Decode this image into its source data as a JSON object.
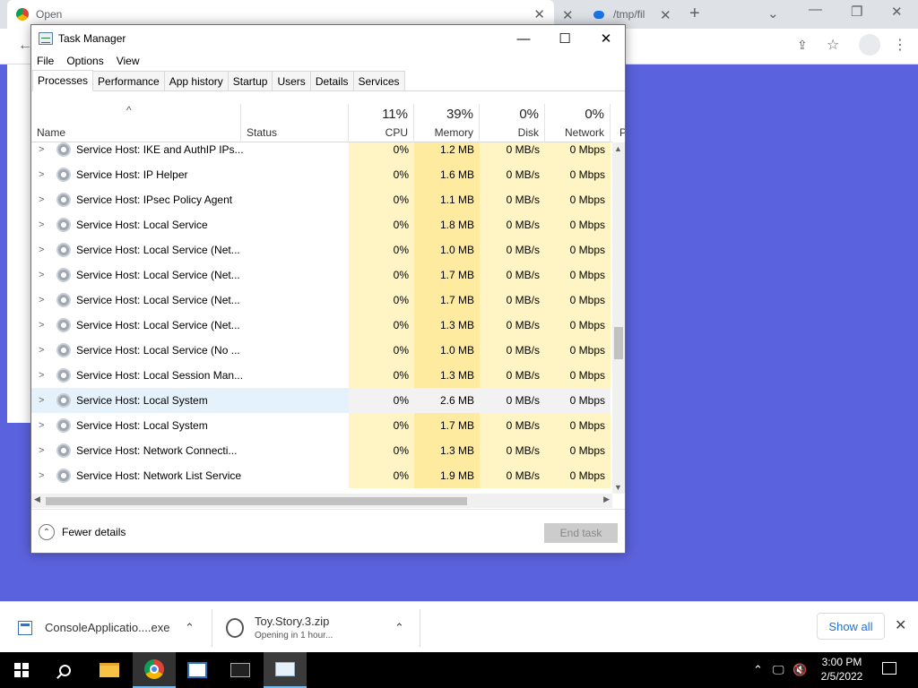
{
  "browser": {
    "tab1_title": "Open",
    "tab2_title": "/tmp/fil",
    "new_tab": "+",
    "close_glyph": "✕"
  },
  "taskmanager": {
    "title": "Task Manager",
    "menu": [
      "File",
      "Options",
      "View"
    ],
    "tabs": [
      "Processes",
      "Performance",
      "App history",
      "Startup",
      "Users",
      "Details",
      "Services"
    ],
    "headers": {
      "name": "Name",
      "status": "Status",
      "cpu_pct": "11%",
      "cpu": "CPU",
      "mem_pct": "39%",
      "mem": "Memory",
      "disk_pct": "0%",
      "disk": "Disk",
      "net_pct": "0%",
      "net": "Network",
      "power": "P"
    },
    "rows": [
      {
        "name": "Service Host: IKE and AuthIP IPs...",
        "cpu": "0%",
        "mem": "1.2 MB",
        "disk": "0 MB/s",
        "net": "0 Mbps"
      },
      {
        "name": "Service Host: IP Helper",
        "cpu": "0%",
        "mem": "1.6 MB",
        "disk": "0 MB/s",
        "net": "0 Mbps"
      },
      {
        "name": "Service Host: IPsec Policy Agent",
        "cpu": "0%",
        "mem": "1.1 MB",
        "disk": "0 MB/s",
        "net": "0 Mbps"
      },
      {
        "name": "Service Host: Local Service",
        "cpu": "0%",
        "mem": "1.8 MB",
        "disk": "0 MB/s",
        "net": "0 Mbps"
      },
      {
        "name": "Service Host: Local Service (Net...",
        "cpu": "0%",
        "mem": "1.0 MB",
        "disk": "0 MB/s",
        "net": "0 Mbps"
      },
      {
        "name": "Service Host: Local Service (Net...",
        "cpu": "0%",
        "mem": "1.7 MB",
        "disk": "0 MB/s",
        "net": "0 Mbps"
      },
      {
        "name": "Service Host: Local Service (Net...",
        "cpu": "0%",
        "mem": "1.7 MB",
        "disk": "0 MB/s",
        "net": "0 Mbps"
      },
      {
        "name": "Service Host: Local Service (Net...",
        "cpu": "0%",
        "mem": "1.3 MB",
        "disk": "0 MB/s",
        "net": "0 Mbps"
      },
      {
        "name": "Service Host: Local Service (No ...",
        "cpu": "0%",
        "mem": "1.0 MB",
        "disk": "0 MB/s",
        "net": "0 Mbps"
      },
      {
        "name": "Service Host: Local Session Man...",
        "cpu": "0%",
        "mem": "1.3 MB",
        "disk": "0 MB/s",
        "net": "0 Mbps"
      },
      {
        "name": "Service Host: Local System",
        "cpu": "0%",
        "mem": "2.6 MB",
        "disk": "0 MB/s",
        "net": "0 Mbps"
      },
      {
        "name": "Service Host: Local System",
        "cpu": "0%",
        "mem": "1.7 MB",
        "disk": "0 MB/s",
        "net": "0 Mbps"
      },
      {
        "name": "Service Host: Network Connecti...",
        "cpu": "0%",
        "mem": "1.3 MB",
        "disk": "0 MB/s",
        "net": "0 Mbps"
      },
      {
        "name": "Service Host: Network List Service",
        "cpu": "0%",
        "mem": "1.9 MB",
        "disk": "0 MB/s",
        "net": "0 Mbps"
      }
    ],
    "fewer_details": "Fewer details",
    "end_task": "End task"
  },
  "downloads": {
    "item1_name": "ConsoleApplicatio....exe",
    "item2_name": "Toy.Story.3.zip",
    "item2_status": "Opening in 1 hour...",
    "show_all": "Show all"
  },
  "taskbar": {
    "time": "3:00 PM",
    "date": "2/5/2022"
  },
  "colors": {
    "desktop": "#5b62dd",
    "heat_light": "#fff4c4",
    "heat_dark": "#ffeba0"
  }
}
